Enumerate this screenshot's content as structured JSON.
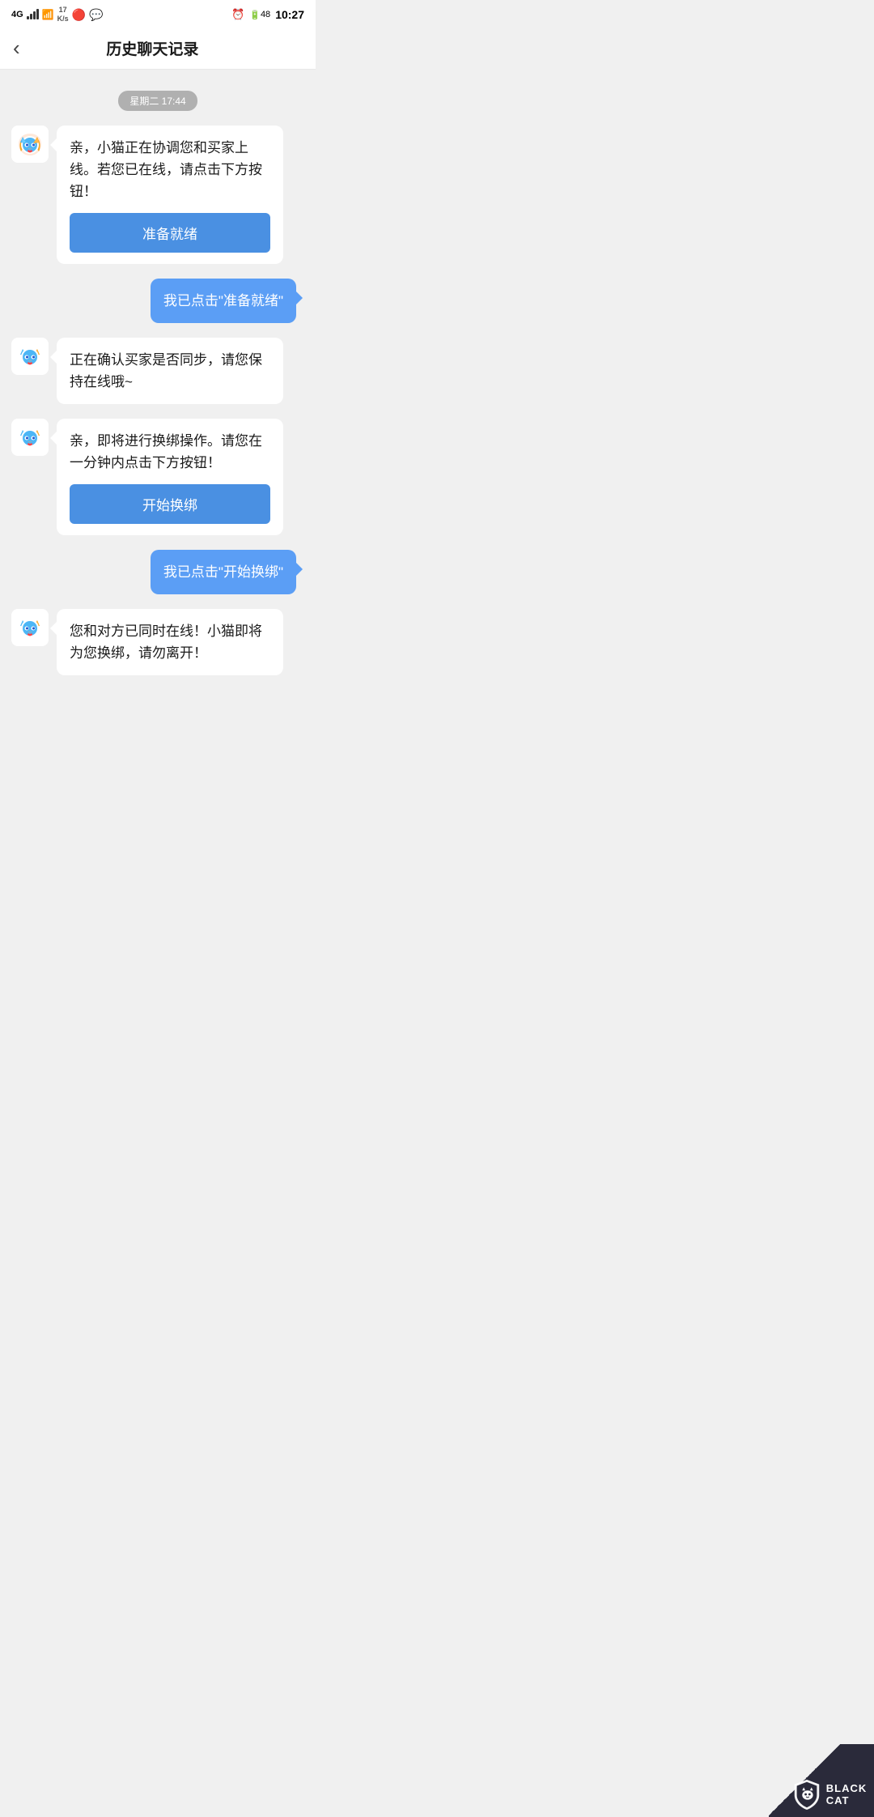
{
  "statusBar": {
    "signal": "4G",
    "wifi": "WiFi",
    "speed": "17\nK/s",
    "battery": "48",
    "time": "10:27"
  },
  "header": {
    "backLabel": "‹",
    "title": "历史聊天记录"
  },
  "chat": {
    "timestamp": "星期二 17:44",
    "messages": [
      {
        "type": "bot",
        "text": "亲，小猫正在协调您和买家上线。若您已在线，请点击下方按钮！",
        "actionBtn": "准备就绪"
      },
      {
        "type": "user",
        "text": "我已点击\"准备就绪\""
      },
      {
        "type": "bot",
        "text": "正在确认买家是否同步，请您保持在线哦~"
      },
      {
        "type": "bot",
        "text": "亲，即将进行换绑操作。请您在一分钟内点击下方按钮！",
        "actionBtn": "开始换绑"
      },
      {
        "type": "user",
        "text": "我已点击\"开始换绑\""
      },
      {
        "type": "bot",
        "text": "您和对方已同时在线！小猫即将为您换绑，请勿离开！"
      }
    ]
  },
  "watermark": {
    "black": "BLACK",
    "cat": "CAT"
  }
}
